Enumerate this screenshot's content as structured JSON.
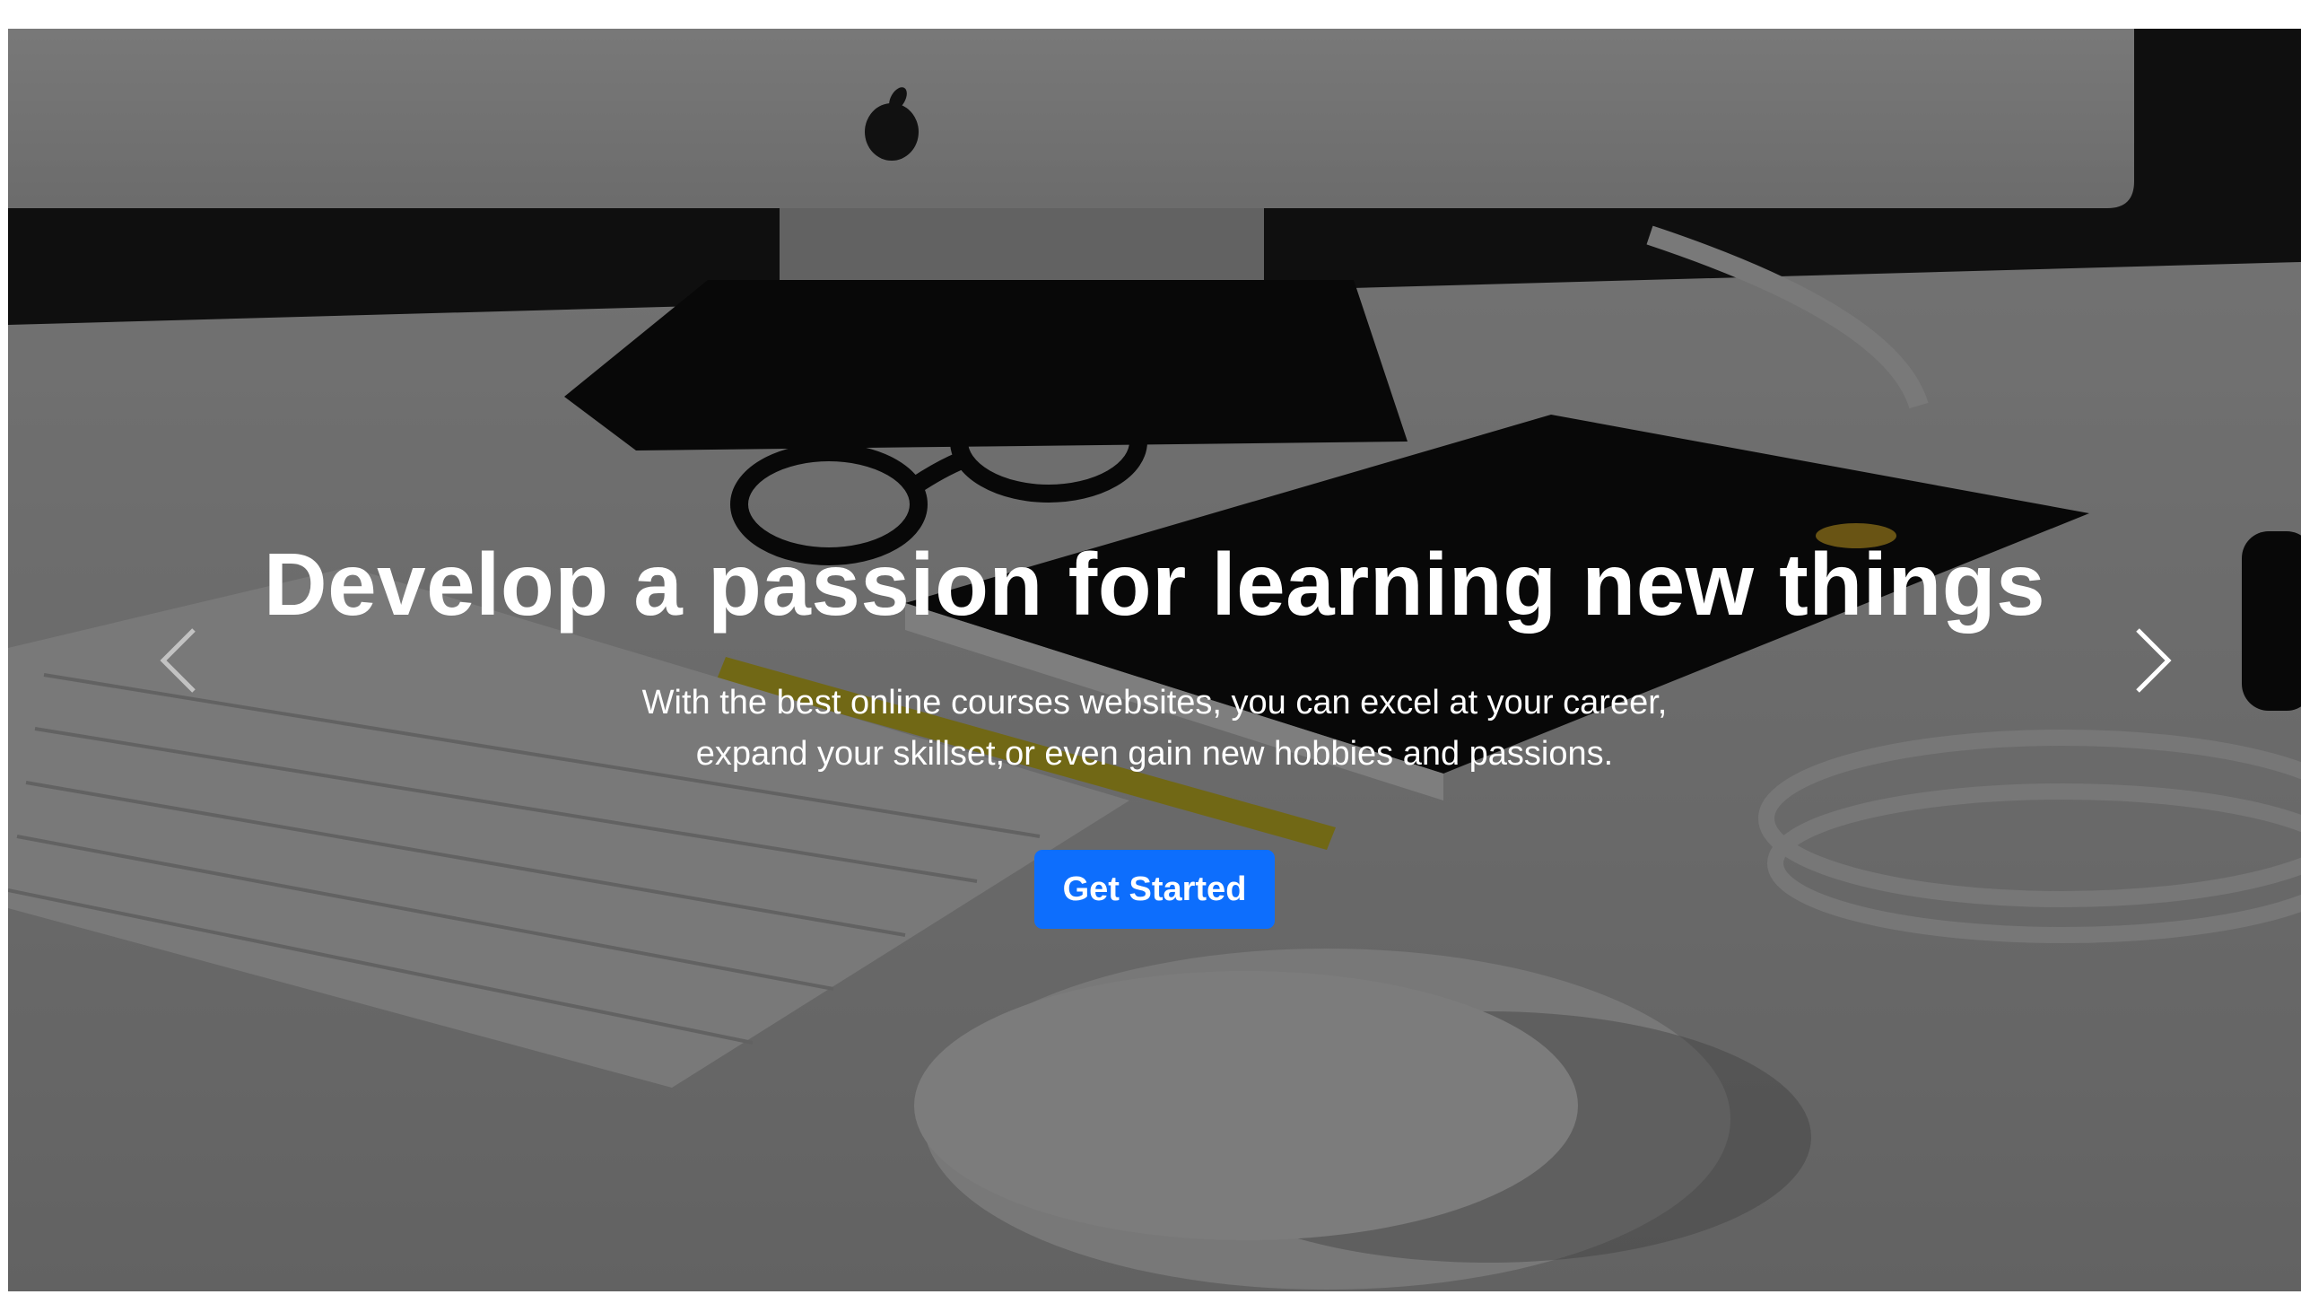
{
  "hero": {
    "headline": "Develop a passion for learning new things",
    "subtitle": "With the best online courses websites, you can excel at your career, expand your skillset,or even gain new hobbies and passions.",
    "cta_label": "Get Started"
  },
  "controls": {
    "prev_icon": "chevron-left-icon",
    "next_icon": "chevron-right-icon"
  },
  "colors": {
    "cta_background": "#0d6efd",
    "text": "#ffffff"
  }
}
